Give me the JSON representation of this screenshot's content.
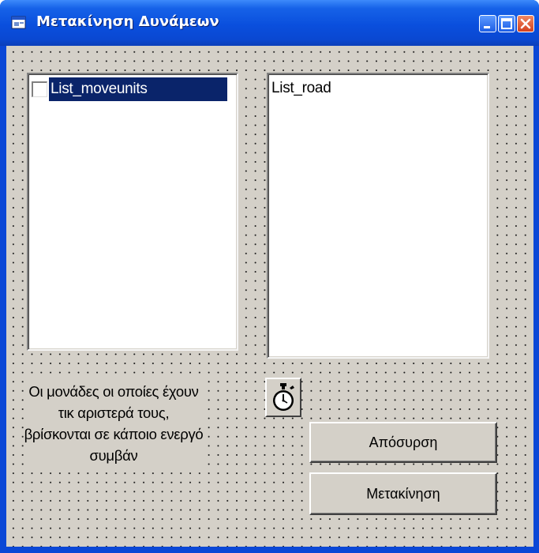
{
  "window": {
    "title": "Μετακίνηση Δυνάμεων",
    "title_icon": "app-window-icon",
    "caption_buttons": [
      "minimize-icon",
      "maximize-icon",
      "close-icon"
    ]
  },
  "list_moveunits": {
    "items": [
      {
        "label": "List_moveunits",
        "checked": false,
        "selected": true
      }
    ]
  },
  "list_road": {
    "items": [
      {
        "label": "List_road"
      }
    ]
  },
  "info_label": {
    "text": "Οι μονάδες οι οποίες έχουν τικ αριστερά τους, βρίσκονται σε κάποιο ενεργό συμβάν"
  },
  "timer": {
    "icon": "stopwatch-icon"
  },
  "buttons": {
    "withdraw_label": "Απόσυρση",
    "move_label": "Μετακίνηση"
  },
  "colors": {
    "title_bar": "#0a4fdd",
    "client_bg": "#d4d0c8",
    "selection": "#0a246a",
    "close_button": "#d4411e"
  }
}
